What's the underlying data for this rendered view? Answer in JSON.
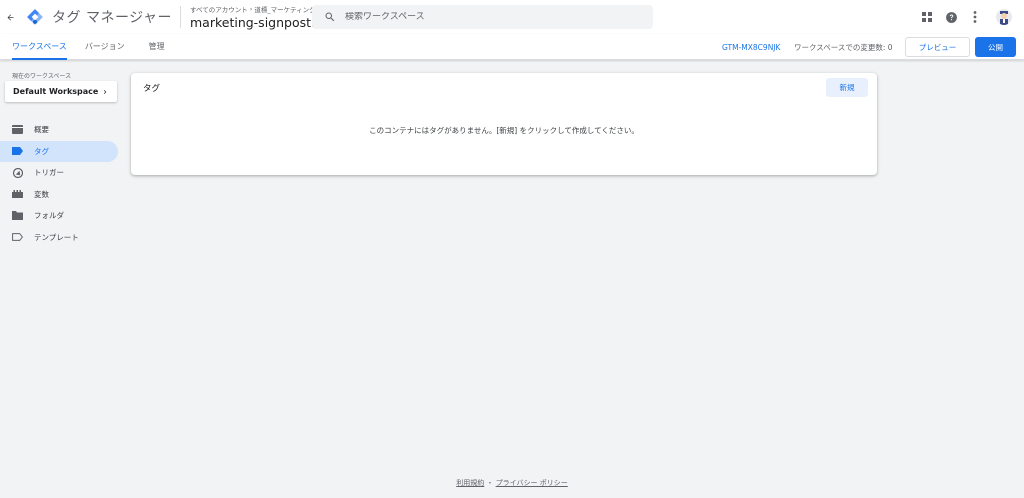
{
  "header": {
    "app_title": "タグ マネージャー",
    "breadcrumb_account": "すべてのアカウント",
    "breadcrumb_separator": "›",
    "breadcrumb_current": "道標_マーケティング",
    "container_name": "marketing-signpost.net",
    "search_placeholder": "検索ワークスペース",
    "icons": [
      "back-arrow-icon",
      "gtm-logo-icon",
      "dropdown-icon",
      "search-icon",
      "apps-grid-icon",
      "help-icon",
      "more-vert-icon",
      "user-avatar"
    ]
  },
  "subnav": {
    "tabs": [
      {
        "label": "ワークスペース",
        "active": true
      },
      {
        "label": "バージョン",
        "active": false
      },
      {
        "label": "管理",
        "active": false
      }
    ],
    "container_id": "GTM-MX8C9NJK",
    "changes_label": "ワークスペースでの変更数: 0",
    "preview_label": "プレビュー",
    "publish_label": "公開"
  },
  "sidebar": {
    "workspace_label": "現在のワークスペース",
    "workspace_name": "Default Workspace",
    "items": [
      {
        "label": "概要",
        "icon": "overview-icon",
        "active": false
      },
      {
        "label": "タグ",
        "icon": "tag-icon",
        "active": true
      },
      {
        "label": "トリガー",
        "icon": "trigger-icon",
        "active": false
      },
      {
        "label": "変数",
        "icon": "variables-icon",
        "active": false
      },
      {
        "label": "フォルダ",
        "icon": "folder-icon",
        "active": false
      },
      {
        "label": "テンプレート",
        "icon": "template-icon",
        "active": false
      }
    ]
  },
  "main": {
    "card_title": "タグ",
    "new_button": "新規",
    "empty_message": "このコンテナにはタグがありません。[新規] をクリックして作成してください。"
  },
  "footer": {
    "terms": "利用規約",
    "separator": "・",
    "privacy": "プライバシー ポリシー"
  },
  "colors": {
    "accent": "#1a73e8",
    "active_nav_bg": "#d2e3fc",
    "page_bg": "#f1f3f4"
  }
}
